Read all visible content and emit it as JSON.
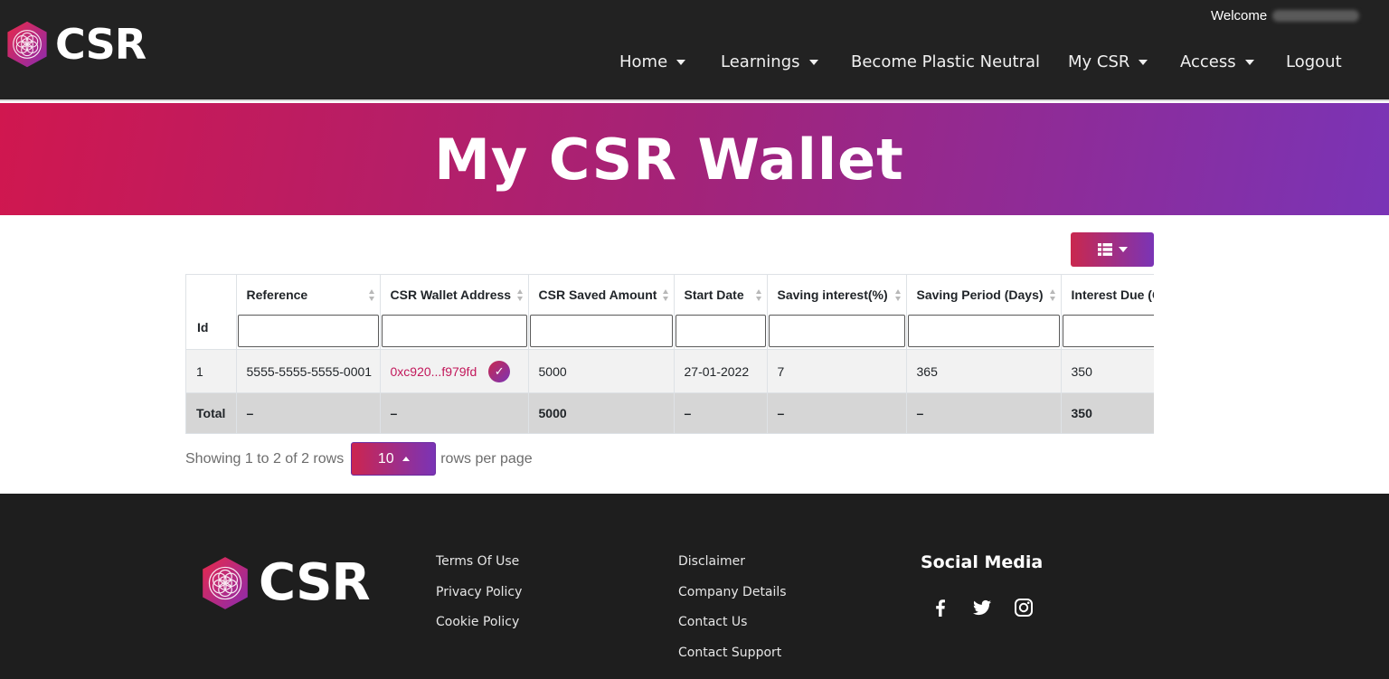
{
  "brand": {
    "name": "CSR"
  },
  "header": {
    "welcome": "Welcome",
    "nav": [
      {
        "label": "Home",
        "dropdown": true
      },
      {
        "label": "Learnings",
        "dropdown": true
      },
      {
        "label": "Become Plastic Neutral",
        "dropdown": false
      },
      {
        "label": "My CSR",
        "dropdown": true
      },
      {
        "label": "Access",
        "dropdown": true
      },
      {
        "label": "Logout",
        "dropdown": false
      }
    ]
  },
  "banner": {
    "title": "My CSR Wallet"
  },
  "table": {
    "columns": [
      "Id",
      "Reference",
      "CSR Wallet Address",
      "CSR Saved Amount",
      "Start Date",
      "Saving interest(%)",
      "Saving Period (Days)",
      "Interest Due (C"
    ],
    "rows": [
      {
        "id": "1",
        "reference": "5555-5555-5555-0001",
        "address": "0xc920...f979fd",
        "saved_amount": "5000",
        "start_date": "27-01-2022",
        "interest": "7",
        "period": "365",
        "interest_due": "350"
      }
    ],
    "total": {
      "label": "Total",
      "reference": "–",
      "address": "–",
      "saved_amount": "5000",
      "start_date": "–",
      "interest": "–",
      "period": "–",
      "interest_due": "350"
    }
  },
  "pagination": {
    "showing": "Showing 1 to 2 of 2 rows",
    "page_size": "10",
    "per_page": "rows per page"
  },
  "footer": {
    "links_col1": [
      "Terms Of Use",
      "Privacy Policy",
      "Cookie Policy"
    ],
    "links_col2": [
      "Disclaimer",
      "Company Details",
      "Contact Us",
      "Contact Support"
    ],
    "social_title": "Social Media",
    "social_icons": [
      "facebook-icon",
      "twitter-icon",
      "instagram-icon"
    ]
  },
  "colors": {
    "accent_red": "#d0174f",
    "accent_purple": "#7a34b6",
    "header_bg": "#222222",
    "link": "#c2185b"
  }
}
